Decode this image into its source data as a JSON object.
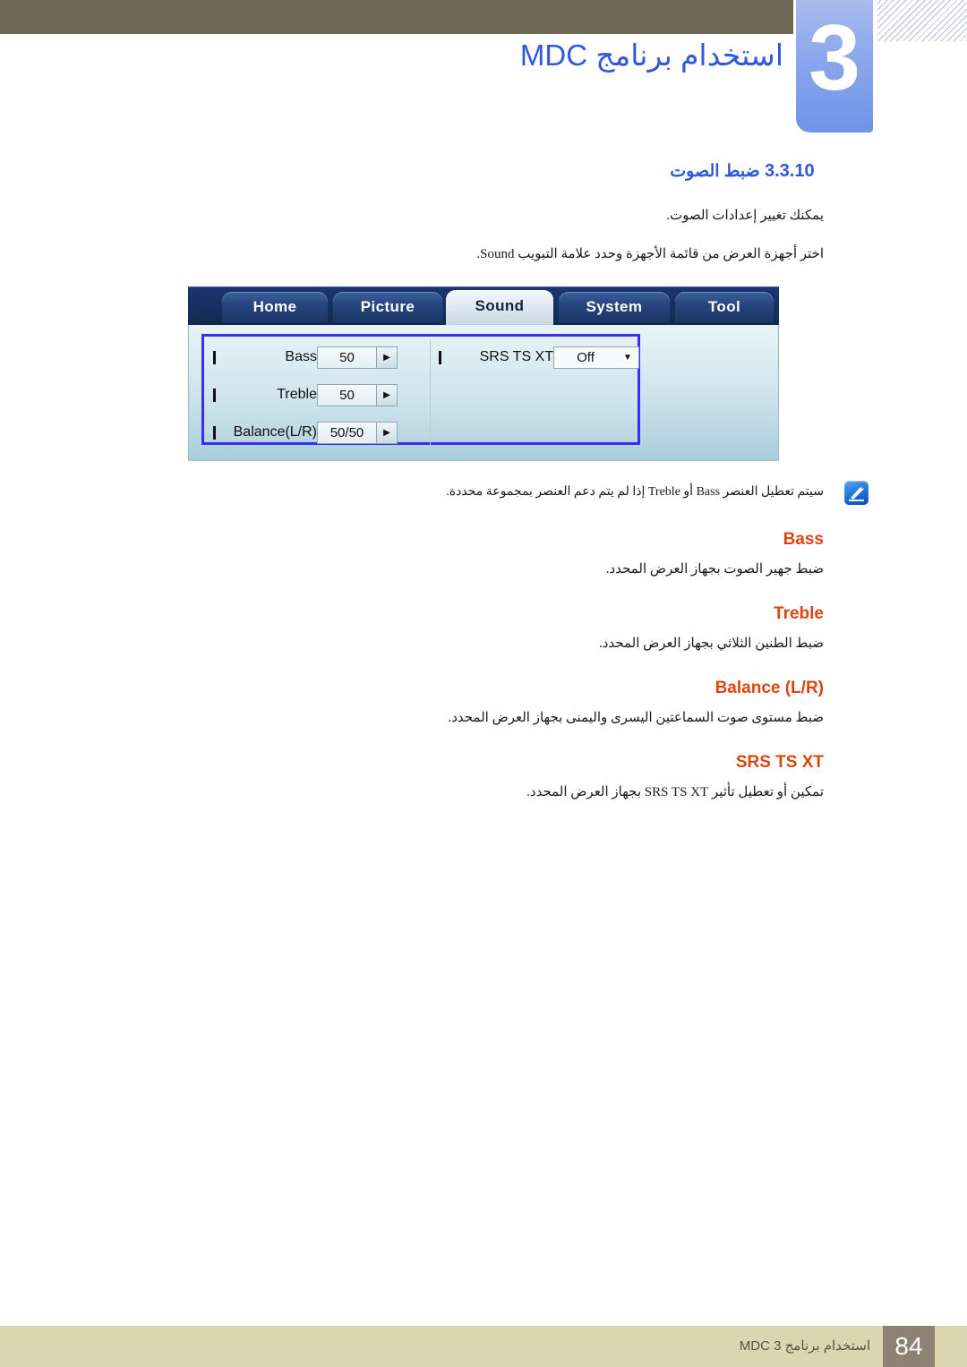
{
  "header": {
    "chapter_number": "3",
    "chapter_title": "استخدام برنامج MDC"
  },
  "section": {
    "number": "3.3.10",
    "title": "ضبط الصوت",
    "intro": "يمكنك تغيير إعدادات الصوت.",
    "instruction": "اختر أجهزة العرض من قائمة الأجهزة وحدد علامة التبويب Sound."
  },
  "mdc_panel": {
    "tabs": [
      {
        "label": "Home",
        "active": false
      },
      {
        "label": "Picture",
        "active": false
      },
      {
        "label": "Sound",
        "active": true
      },
      {
        "label": "System",
        "active": false
      },
      {
        "label": "Tool",
        "active": false
      }
    ],
    "controls": {
      "bass": {
        "label": "Bass",
        "value": "50"
      },
      "treble": {
        "label": "Treble",
        "value": "50"
      },
      "balance": {
        "label": "Balance(L/R)",
        "value": "50/50"
      },
      "srs": {
        "label": "SRS TS XT",
        "value": "Off"
      }
    },
    "spinner_arrow": "▶",
    "combo_arrow": "▼"
  },
  "note": {
    "icon_name": "note-pencil-icon",
    "text": "سيتم تعطيل العنصر Bass أو Treble إذا لم يتم دعم العنصر بمجموعة محددة."
  },
  "terms": [
    {
      "name": "Bass",
      "description": "ضبط جهير الصوت بجهاز العرض المحدد."
    },
    {
      "name": "Treble",
      "description": "ضبط الطنين الثلاثي بجهاز العرض المحدد."
    },
    {
      "name": "Balance (L/R)",
      "description": "ضبط مستوى صوت السماعتين اليسرى واليمنى بجهاز العرض المحدد."
    },
    {
      "name": "SRS TS XT",
      "description": "تمكين أو تعطيل تأثير SRS TS XT بجهاز العرض المحدد."
    }
  ],
  "footer": {
    "page_number": "84",
    "text": "استخدام برنامج MDC 3"
  },
  "colors": {
    "band": "#6c6a55",
    "chapter_tab": "#8ba6ec",
    "heading_blue": "#2f59d8",
    "term_orange": "#d9470e",
    "footer_bar": "#dcd6b0",
    "footer_page_box": "#8d8273"
  }
}
